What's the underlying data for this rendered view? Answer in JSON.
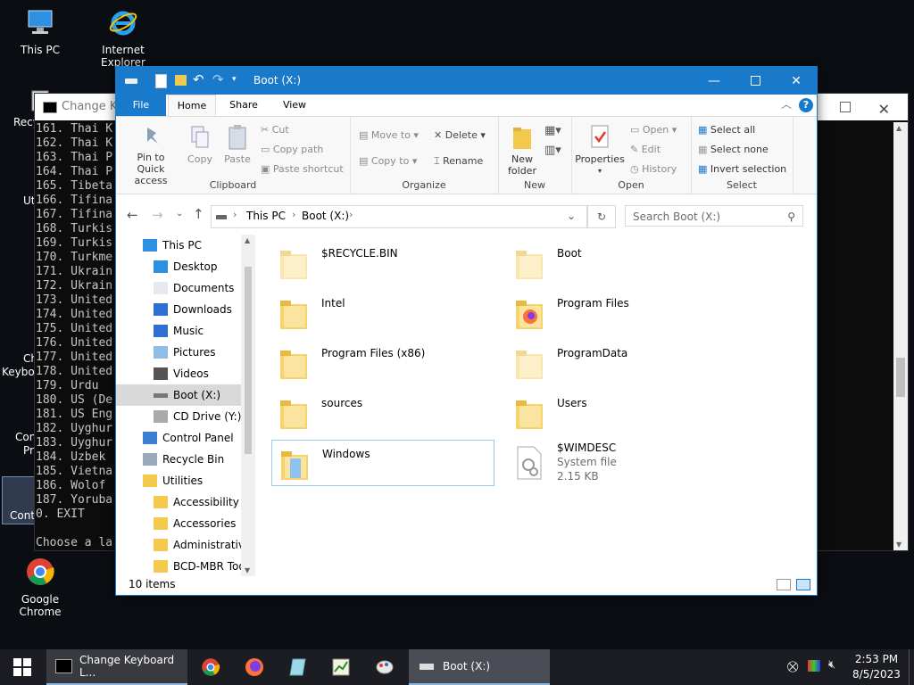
{
  "desktop": {
    "icons": [
      {
        "label": "This PC",
        "icon": "computer-icon"
      },
      {
        "label": "Internet Explorer",
        "icon": "internet-explorer-icon"
      },
      {
        "label": "Google Chrome",
        "icon": "chrome-icon"
      }
    ],
    "partial_labels": [
      "Recy",
      "Ut",
      "Ch",
      "Keyboa",
      "Contr",
      "Pro",
      "Contro"
    ]
  },
  "console": {
    "title": "Change Key",
    "lines": [
      "161. Thai K",
      "162. Thai K",
      "163. Thai P",
      "164. Thai P",
      "165. Tibeta",
      "166. Tifina",
      "167. Tifina",
      "168. Turkis",
      "169. Turkis",
      "170. Turkme",
      "171. Ukrain",
      "172. Ukrain",
      "173. United",
      "174. United",
      "175. United",
      "176. United",
      "177. United",
      "178. United",
      "179. Urdu",
      "180. US (De",
      "181. US Eng",
      "182. Uyghur",
      "183. Uyghur",
      "184. Uzbek",
      "185. Vietna",
      "186. Wolof",
      "187. Yoruba",
      "0. EXIT",
      "",
      "Choose a la"
    ]
  },
  "explorer": {
    "title": "Boot (X:)",
    "tabs": [
      "File",
      "Home",
      "Share",
      "View"
    ],
    "active_tab": "Home",
    "ribbon": {
      "clipboard": {
        "label": "Clipboard",
        "pin": "Pin to Quick access",
        "copy": "Copy",
        "paste": "Paste",
        "cut": "Cut",
        "copy_path": "Copy path",
        "paste_shortcut": "Paste shortcut"
      },
      "organize": {
        "label": "Organize",
        "move_to": "Move to",
        "copy_to": "Copy to",
        "delete": "Delete",
        "rename": "Rename"
      },
      "new": {
        "label": "New",
        "new_folder": "New folder"
      },
      "open": {
        "label": "Open",
        "properties": "Properties",
        "open": "Open",
        "edit": "Edit",
        "history": "History"
      },
      "select": {
        "label": "Select",
        "select_all": "Select all",
        "select_none": "Select none",
        "invert": "Invert selection"
      }
    },
    "address": {
      "crumbs": [
        "This PC",
        "Boot (X:)"
      ]
    },
    "search": {
      "placeholder": "Search Boot (X:)"
    },
    "nav": [
      {
        "label": "This PC",
        "icon": "computer-icon",
        "indent": 0
      },
      {
        "label": "Desktop",
        "icon": "desktop-icon",
        "indent": 1
      },
      {
        "label": "Documents",
        "icon": "documents-icon",
        "indent": 1
      },
      {
        "label": "Downloads",
        "icon": "downloads-icon",
        "indent": 1
      },
      {
        "label": "Music",
        "icon": "music-icon",
        "indent": 1
      },
      {
        "label": "Pictures",
        "icon": "pictures-icon",
        "indent": 1
      },
      {
        "label": "Videos",
        "icon": "videos-icon",
        "indent": 1
      },
      {
        "label": "Boot (X:)",
        "icon": "drive-icon",
        "indent": 1,
        "selected": true
      },
      {
        "label": "CD Drive (Y:) H",
        "icon": "cd-drive-icon",
        "indent": 1
      },
      {
        "label": "Control Panel",
        "icon": "control-panel-icon",
        "indent": 0
      },
      {
        "label": "Recycle Bin",
        "icon": "recycle-bin-icon",
        "indent": 0
      },
      {
        "label": "Utilities",
        "icon": "folder-icon",
        "indent": 0
      },
      {
        "label": "Accessibility",
        "icon": "folder-icon",
        "indent": 1
      },
      {
        "label": "Accessories",
        "icon": "folder-icon",
        "indent": 1
      },
      {
        "label": "Administrative",
        "icon": "folder-icon",
        "indent": 1
      },
      {
        "label": "BCD-MBR Tool",
        "icon": "folder-icon",
        "indent": 1
      }
    ],
    "files": [
      {
        "name": "$RECYCLE.BIN",
        "type": "folder",
        "hidden": true
      },
      {
        "name": "Boot",
        "type": "folder",
        "hidden": true
      },
      {
        "name": "Intel",
        "type": "folder"
      },
      {
        "name": "Program Files",
        "type": "folder-special"
      },
      {
        "name": "Program Files (x86)",
        "type": "folder"
      },
      {
        "name": "ProgramData",
        "type": "folder",
        "hidden": true
      },
      {
        "name": "sources",
        "type": "folder"
      },
      {
        "name": "Users",
        "type": "folder"
      },
      {
        "name": "Windows",
        "type": "folder",
        "selected": true
      },
      {
        "name": "$WIMDESC",
        "type": "file",
        "subtitle": "System file",
        "size": "2.15 KB"
      }
    ],
    "status": "10 items"
  },
  "taskbar": {
    "items": [
      {
        "label": "Change Keyboard L...",
        "icon": "cmd-icon"
      },
      {
        "label": "Boot (X:)",
        "icon": "drive-icon",
        "active": true
      }
    ],
    "clock": {
      "time": "2:53 PM",
      "date": "8/5/2023"
    }
  },
  "colors": {
    "accent": "#1979ca",
    "taskbar": "#1b1d22",
    "console_bg": "#0c0c0c"
  }
}
